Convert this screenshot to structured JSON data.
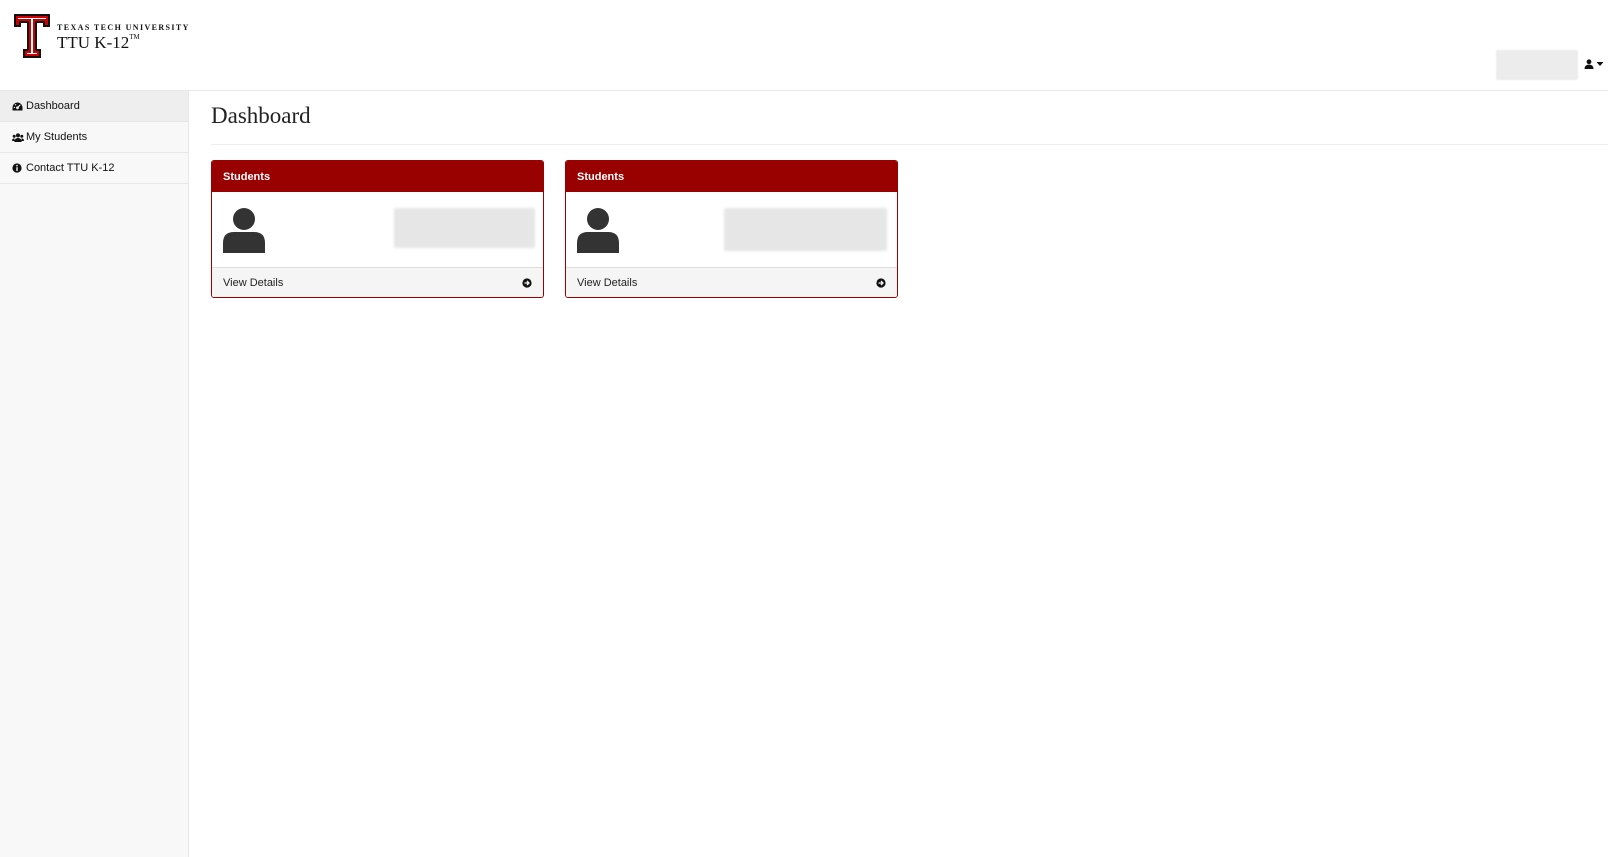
{
  "header": {
    "brand_university": "TEXAS TECH UNIVERSITY",
    "brand_name": "TTU K-12",
    "brand_mark": "TM",
    "user_menu_icon": "user-icon",
    "brand_color": "#CC0000"
  },
  "sidebar": {
    "items": [
      {
        "label": "Dashboard",
        "icon": "dashboard-icon",
        "active": true
      },
      {
        "label": "My Students",
        "icon": "users-icon",
        "active": false
      },
      {
        "label": "Contact TTU K-12",
        "icon": "info-circle-icon",
        "active": false
      }
    ]
  },
  "main": {
    "title": "Dashboard",
    "panels": [
      {
        "heading": "Students",
        "footer": "View Details",
        "icon": "user-icon"
      },
      {
        "heading": "Students",
        "footer": "View Details",
        "icon": "user-icon"
      }
    ]
  },
  "colors": {
    "panel_primary": "#990000",
    "sidebar_bg": "#f8f8f8"
  }
}
